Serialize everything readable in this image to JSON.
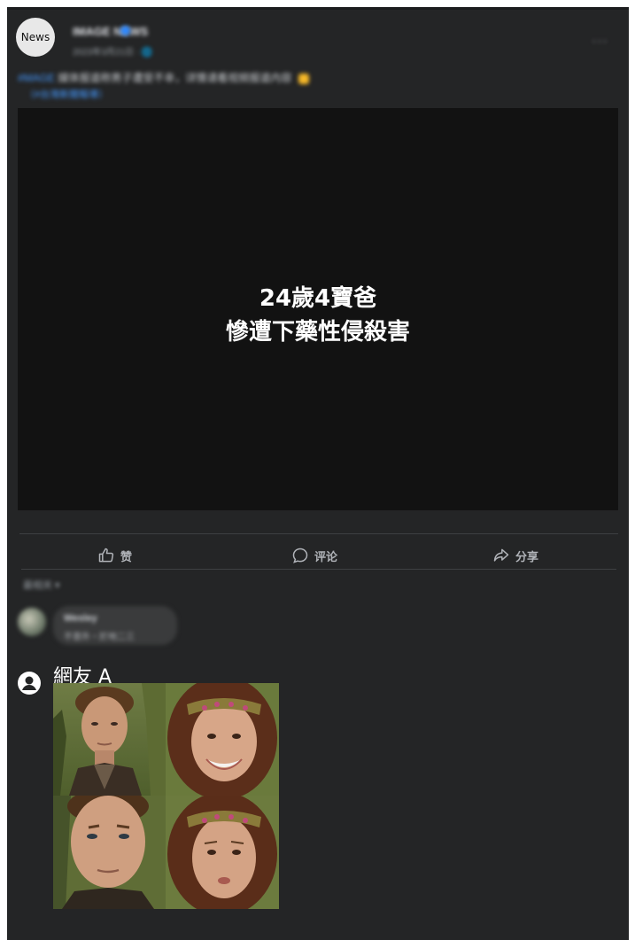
{
  "post": {
    "avatar_label": "News",
    "page_name": "IMAGE NEWS",
    "timestamp": "2023年3月21日 · 🌐",
    "more": "···",
    "caption_tag": "#MAGE",
    "caption_text": "媒体报道称男子遭受不幸，详情请看视频报道内容",
    "caption_link": "（#台灣新聞報導）"
  },
  "video": {
    "title_line1": "24歲4寶爸",
    "title_line2": "慘遭下藥性侵殺害"
  },
  "actions": {
    "like": "赞",
    "comment": "评论",
    "share": "分享"
  },
  "comments": {
    "sort_label": "最相关 ▾",
    "first": {
      "name": "Wesley",
      "text": "不意外・於地二三"
    }
  },
  "reply": {
    "user_label": "網友 A"
  },
  "colors": {
    "card_bg": "#242526",
    "video_bg": "#121212",
    "accent": "#2d88ff"
  }
}
